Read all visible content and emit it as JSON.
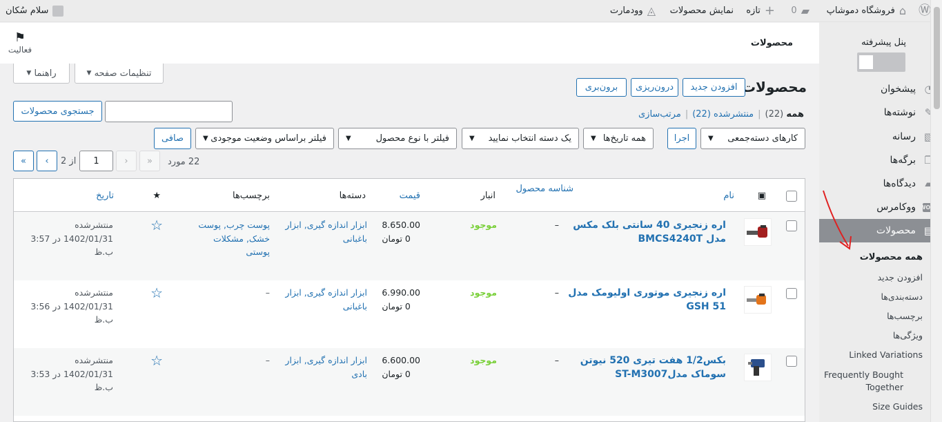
{
  "adminbar": {
    "site_name": "فروشگاه دموشاپ",
    "comments_count": "0",
    "new_label": "تازه",
    "view_products": "نمایش محصولات",
    "woodmart": "وودمارت",
    "greeting": "سلام سُکان"
  },
  "sidebar": {
    "advanced_panel": "پنل پیشرفته",
    "items": [
      {
        "label": "پیشخوان",
        "icon": "dashboard-icon"
      },
      {
        "label": "نوشته‌ها",
        "icon": "pin-icon"
      },
      {
        "label": "رسانه",
        "icon": "media-icon"
      },
      {
        "label": "برگه‌ها",
        "icon": "pages-icon"
      },
      {
        "label": "دیدگاه‌ها",
        "icon": "comments-icon"
      },
      {
        "label": "ووکامرس",
        "icon": "woo-icon"
      },
      {
        "label": "محصولات",
        "icon": "archive-icon"
      }
    ],
    "woo_badge": "WOO",
    "subitems": [
      "همه محصولات",
      "افزودن جدید",
      "دسته‌بندی‌ها",
      "برچسب‌ها",
      "ویژگی‌ها",
      "Linked Variations",
      "Frequently Bought Together",
      "Size Guides"
    ]
  },
  "topbar": {
    "title": "محصولات",
    "activity": "فعالیت"
  },
  "screen": {
    "options": "تنظیمات صفحه",
    "help": "راهنما"
  },
  "page": {
    "heading": "محصولات",
    "add_new": "افزودن جدید",
    "import": "درون‌ریزی",
    "export": "برون‌بری"
  },
  "views": {
    "all": "همه",
    "all_count": "(22)",
    "published": "منتشرشده (22)",
    "sorting": "مرتب‌سازی",
    "sep": "|"
  },
  "search": {
    "button": "جستجوی محصولات",
    "value": ""
  },
  "filters": {
    "bulk": "کارهای دسته‌جمعی",
    "apply": "اجرا",
    "dates": "همه تاریخ‌ها",
    "category": "یک دسته انتخاب نمایید",
    "type": "فیلتر با نوع محصول",
    "stock": "فیلتر براساس وضعیت موجودی",
    "filter_btn": "صافی"
  },
  "pagination": {
    "count": "22 مورد",
    "current": "1",
    "of": "از 2",
    "first": "«",
    "prev": "‹",
    "next": "›",
    "last": "»"
  },
  "table": {
    "headers": {
      "image": "▣",
      "name": "نام",
      "sku": "شناسه محصول",
      "stock": "انبار",
      "price": "قیمت",
      "categories": "دسته‌ها",
      "tags": "برچسب‌ها",
      "featured": "★",
      "date": "تاریخ"
    },
    "rows": [
      {
        "name_line1": "اره زنجیری 40 سانتی بلک مکس",
        "name_line2": "مدل BMCS4240T",
        "sku": "–",
        "stock": "موجود",
        "price": "8.650.00",
        "currency": "0 تومان",
        "categories_line1": "ابزار اندازه گیری, ابزار",
        "categories_line2": "باغبانی",
        "tags_line1": "پوست چرب, پوست",
        "tags_line2": "خشک, مشکلات",
        "tags_line3": "پوستی",
        "status": "منتشرشده",
        "date": "1402/01/31 در 3:57",
        "ampm": "ب.ظ"
      },
      {
        "name_line1": "اره زنجیری موتوری اولیومک مدل",
        "name_line2": "GSH 51",
        "sku": "–",
        "stock": "موجود",
        "price": "6.990.00",
        "currency": "0 تومان",
        "categories_line1": "ابزار اندازه گیری, ابزار",
        "categories_line2": "باغبانی",
        "tags_line1": "–",
        "tags_line2": "",
        "tags_line3": "",
        "status": "منتشرشده",
        "date": "1402/01/31 در 3:56",
        "ampm": "ب.ظ"
      },
      {
        "name_line1": "بکس1/2 هفت تیری 520 نیوتن",
        "name_line2": "سوماک مدلST-M3007",
        "sku": "–",
        "stock": "موجود",
        "price": "6.600.00",
        "currency": "0 تومان",
        "categories_line1": "ابزار اندازه گیری, ابزار",
        "categories_line2": "بادی",
        "tags_line1": "–",
        "tags_line2": "",
        "tags_line3": "",
        "status": "منتشرشده",
        "date": "1402/01/31 در 3:53",
        "ampm": "ب.ظ"
      }
    ]
  },
  "colors": {
    "accent": "#2271b1",
    "instock": "#7ad03a",
    "annotation": "#e02020"
  }
}
